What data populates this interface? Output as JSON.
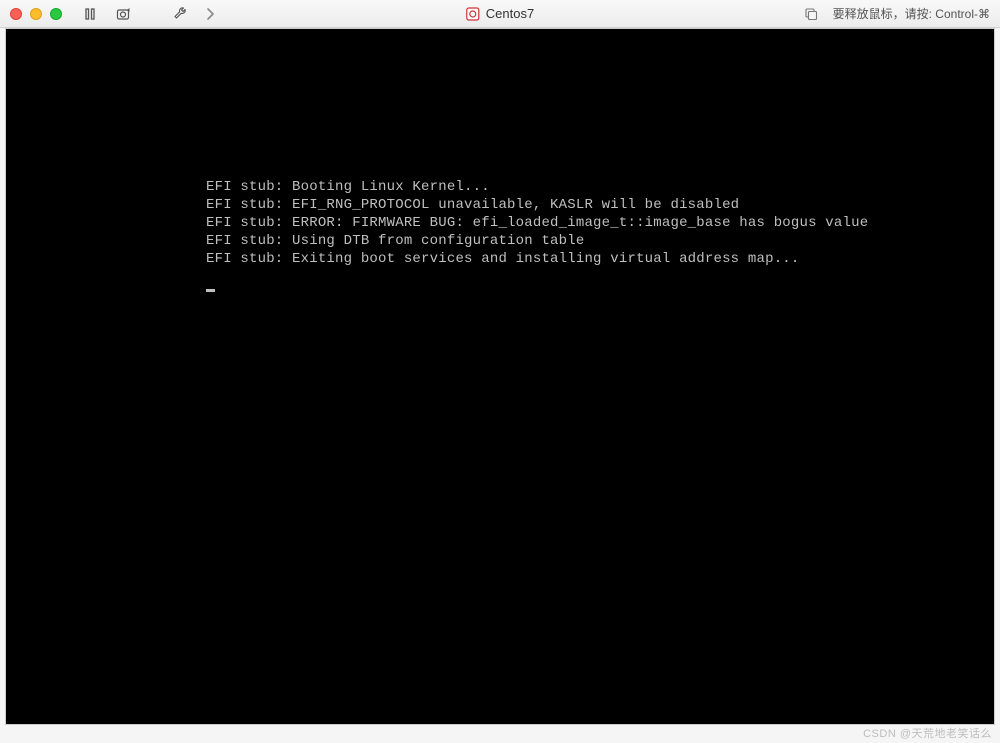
{
  "window": {
    "title": "Centos7",
    "hint": "要释放鼠标，请按: Control-⌘"
  },
  "console": {
    "lines": [
      "EFI stub: Booting Linux Kernel...",
      "EFI stub: EFI_RNG_PROTOCOL unavailable, KASLR will be disabled",
      "EFI stub: ERROR: FIRMWARE BUG: efi_loaded_image_t::image_base has bogus value",
      "EFI stub: Using DTB from configuration table",
      "EFI stub: Exiting boot services and installing virtual address map..."
    ]
  },
  "watermark": "CSDN @天荒地老笑话么"
}
